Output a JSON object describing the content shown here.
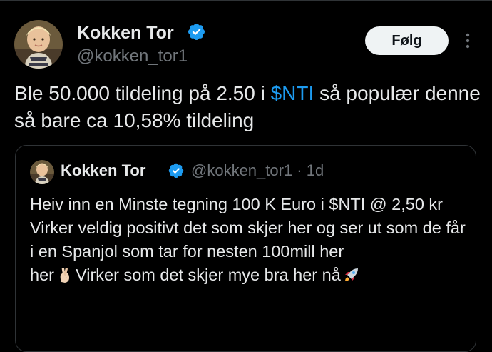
{
  "author": {
    "name": "Kokken Tor",
    "handle": "@kokken_tor1",
    "avatar_icon": "profile-photo-avatar",
    "verified_icon": "verified-badge-icon"
  },
  "actions": {
    "follow_label": "Følg",
    "more_icon": "more-options-icon"
  },
  "tweet": {
    "text_part1": "Ble 50.000 tildeling på 2.50 i ",
    "cashtag": "$NTI",
    "text_part2": " så populær denne så bare ca 10,58% tildeling"
  },
  "quote": {
    "name": "Kokken Tor",
    "handle_time": "@kokken_tor1 · 1d",
    "line1": "Heiv inn en Minste tegning 100 K Euro i $NTI @ 2,50 kr",
    "line2": "Virker veldig positivt det som skjer her og ser ut som de får i en Spanjol som tar for nesten 100mill her",
    "line3": "Virker som det skjer mye bra her nå",
    "emoji_icons": [
      "crossed-fingers-emoji-icon",
      "rocket-emoji-icon"
    ]
  },
  "colors": {
    "background": "#000000",
    "text": "#e7e9ea",
    "secondary_text": "#71767b",
    "accent": "#1d9bf0",
    "border": "#2f3336",
    "follow_button_bg": "#eff3f4"
  }
}
